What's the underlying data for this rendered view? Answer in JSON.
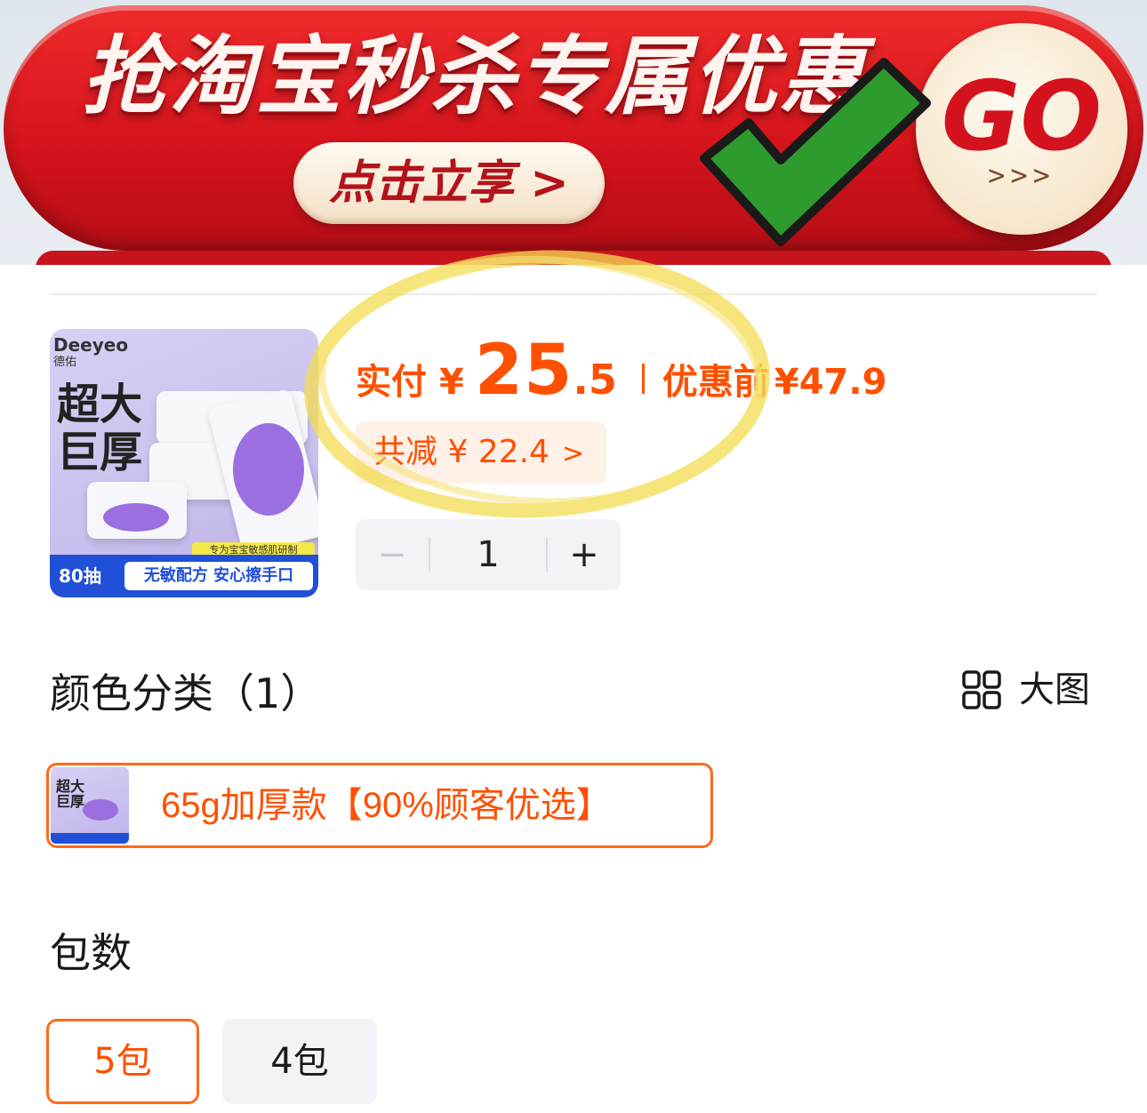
{
  "banner": {
    "title": "抢淘宝秒杀专属优惠",
    "cta_label": "点击立享 >",
    "go_label": "GO",
    "go_arrows": ">>>",
    "checkmark_color": "#2e9b2e"
  },
  "product": {
    "thumb": {
      "brand": "Deeyeo",
      "brand_cn": "德佑",
      "headline": "超大巨厚",
      "tagline": "专为宝宝敏感肌研制",
      "count": "80抽",
      "features": "无敏配方 安心擦手口"
    },
    "price": {
      "label": "实付",
      "currency": "¥",
      "integer": "25",
      "decimal": ".5",
      "original_label": "优惠前",
      "original": "¥47.9",
      "accent_color": "#ff5000"
    },
    "discount": {
      "label": "共减 ¥ 22.4",
      "chevron": ">"
    },
    "quantity": {
      "minus": "−",
      "value": "1",
      "plus": "+"
    }
  },
  "color_section": {
    "title": "颜色分类（1）",
    "big_image_label": "大图",
    "options": [
      {
        "label": "65g加厚款【90%顾客优选】",
        "thumb_text": "超大巨厚",
        "selected": true
      }
    ]
  },
  "pack_section": {
    "title": "包数",
    "options": [
      {
        "label": "5包",
        "selected": true
      },
      {
        "label": "4包",
        "selected": false
      }
    ]
  }
}
